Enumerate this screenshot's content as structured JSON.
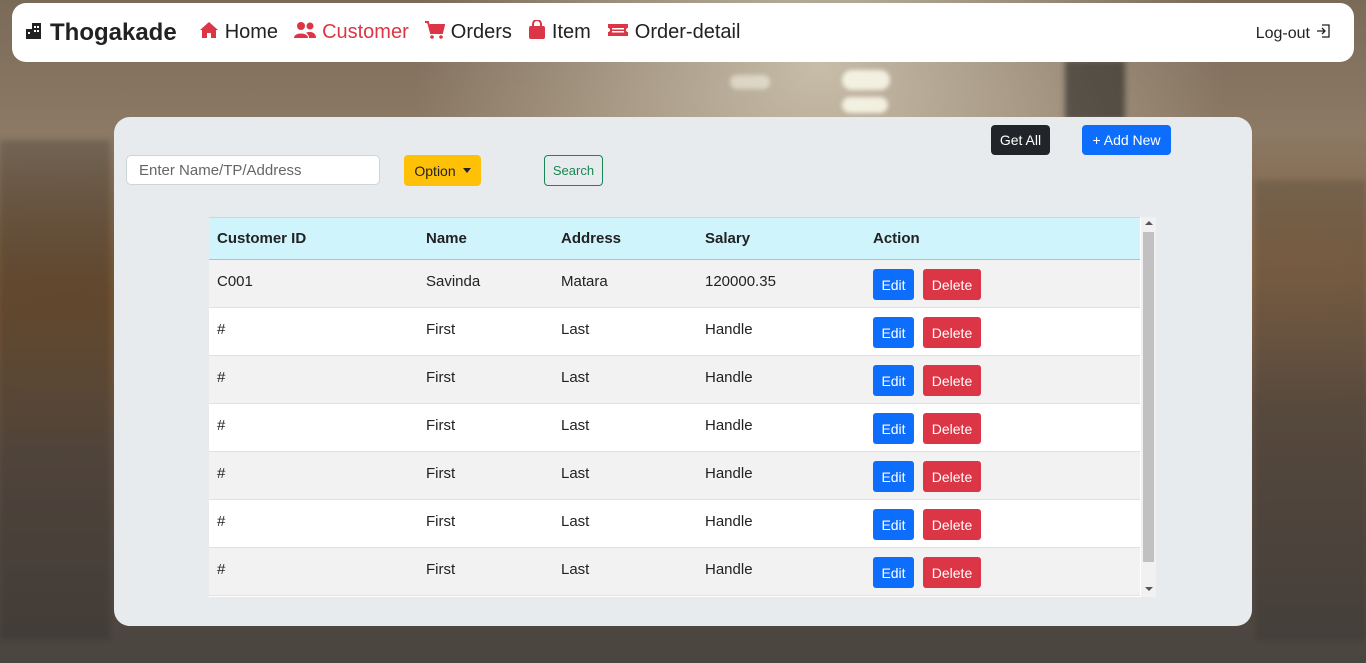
{
  "brand": {
    "name": "Thogakade",
    "icon": "building-icon"
  },
  "nav": {
    "items": [
      {
        "label": "Home",
        "icon": "house-icon",
        "active": false
      },
      {
        "label": "Customer",
        "icon": "people-icon",
        "active": true
      },
      {
        "label": "Orders",
        "icon": "cart-icon",
        "active": false
      },
      {
        "label": "Item",
        "icon": "bag-icon",
        "active": false
      },
      {
        "label": "Order-detail",
        "icon": "ticket-icon",
        "active": false
      }
    ],
    "logout_label": "Log-out"
  },
  "toolbar": {
    "search_placeholder": "Enter Name/TP/Address",
    "option_label": "Option",
    "search_label": "Search",
    "getall_label": "Get All",
    "addnew_label": "+ Add New"
  },
  "table": {
    "headers": [
      "Customer ID",
      "Name",
      "Address",
      "Salary",
      "Action"
    ],
    "rows": [
      [
        "C001",
        "Savinda",
        "Matara",
        "120000.35"
      ],
      [
        "#",
        "First",
        "Last",
        "Handle"
      ],
      [
        "#",
        "First",
        "Last",
        "Handle"
      ],
      [
        "#",
        "First",
        "Last",
        "Handle"
      ],
      [
        "#",
        "First",
        "Last",
        "Handle"
      ],
      [
        "#",
        "First",
        "Last",
        "Handle"
      ],
      [
        "#",
        "First",
        "Last",
        "Handle"
      ]
    ],
    "edit_label": "Edit",
    "delete_label": "Delete"
  },
  "colors": {
    "accent_active": "#dc3545",
    "primary": "#0d6efd",
    "warning": "#ffc107",
    "success": "#198754",
    "dark": "#212529",
    "table_header": "#cff4fc"
  }
}
